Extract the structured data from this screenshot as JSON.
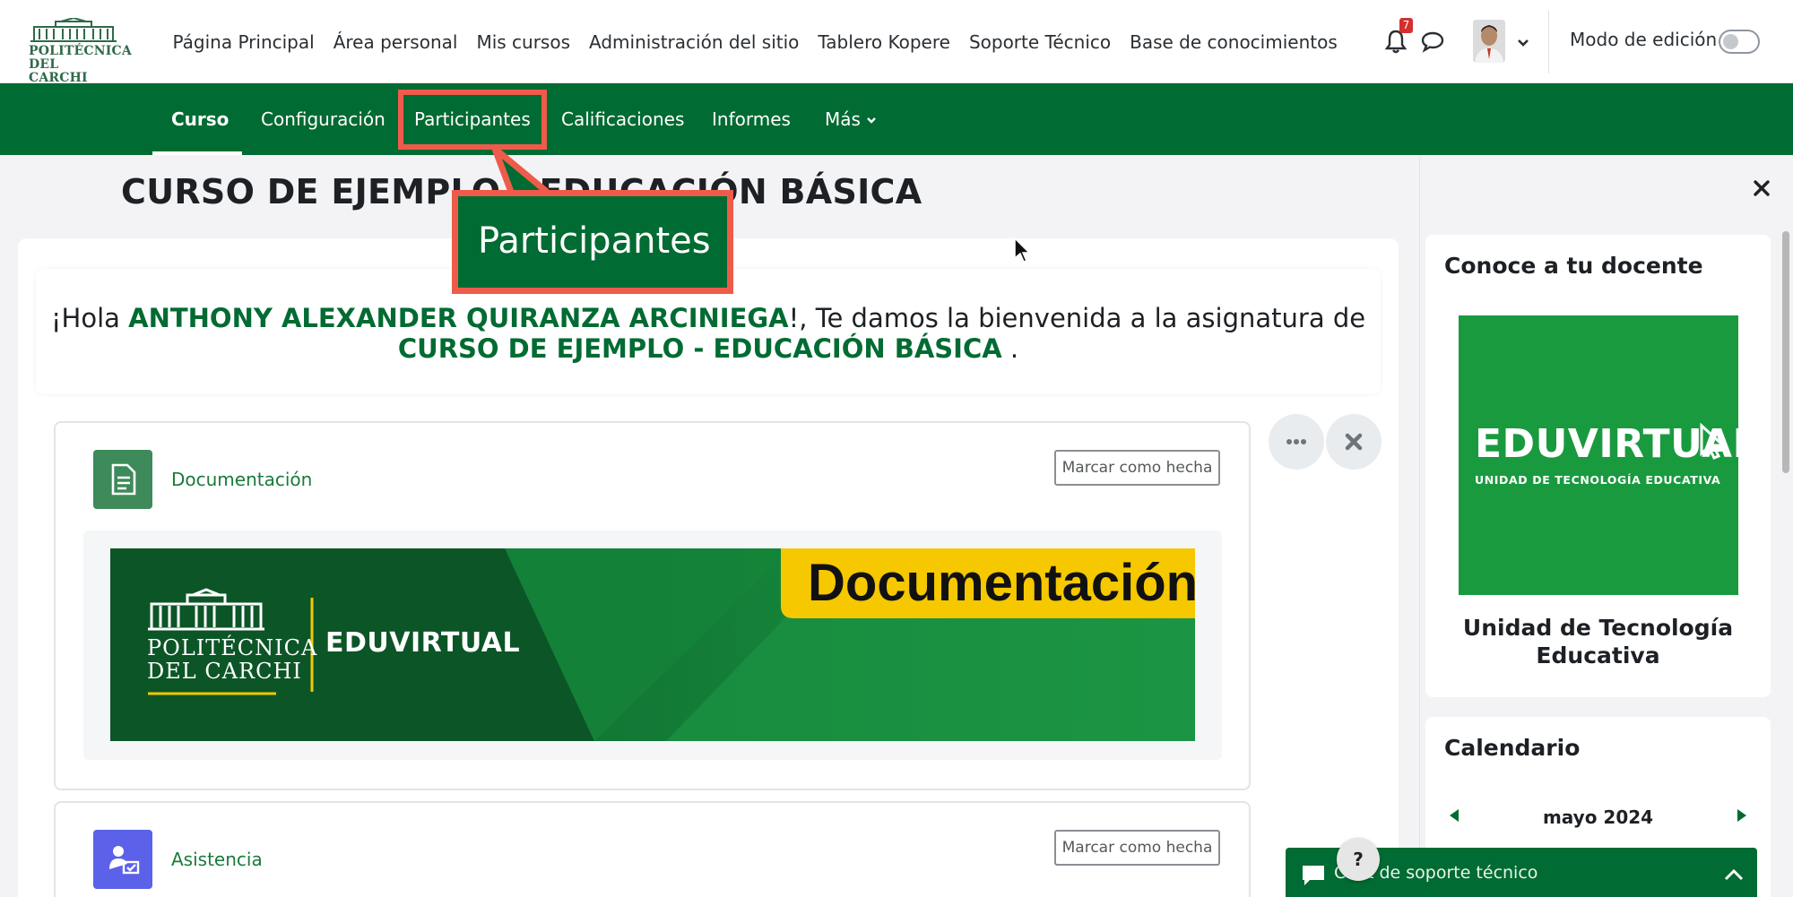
{
  "topbar": {
    "logo_text_line1": "POLITÉCNICA",
    "logo_text_line2": "DEL CARCHI",
    "nav": [
      {
        "label": "Página Principal"
      },
      {
        "label": "Área personal"
      },
      {
        "label": "Mis cursos"
      },
      {
        "label": "Administración del sitio"
      },
      {
        "label": "Tablero Kopere"
      },
      {
        "label": "Soporte Técnico"
      },
      {
        "label": "Base de conocimientos"
      }
    ],
    "notifications_count": "7",
    "edit_mode_label": "Modo de edición",
    "edit_mode_on": false
  },
  "secnav": {
    "tabs": [
      {
        "label": "Curso",
        "active": true
      },
      {
        "label": "Configuración"
      },
      {
        "label": "Participantes",
        "highlighted": true
      },
      {
        "label": "Calificaciones"
      },
      {
        "label": "Informes"
      },
      {
        "label": "Más"
      }
    ]
  },
  "callout": {
    "label": "Participantes",
    "color": "#ef5b4a"
  },
  "page": {
    "title": "CURSO DE EJEMPLO - EDUCACIÓN BÁSICA"
  },
  "welcome": {
    "prefix": "¡Hola ",
    "user_name": "ANTHONY ALEXANDER QUIRANZA ARCINIEGA",
    "middle": "!, Te damos la bienvenida a la asignatura de",
    "course_name": "CURSO DE EJEMPLO - EDUCACIÓN BÁSICA",
    "suffix": " ."
  },
  "activities": [
    {
      "name": "Documentación",
      "icon": "file-icon",
      "icon_color": "#3f8a5a",
      "mark_label": "Marcar como hecha",
      "banner": {
        "logo_line1": "POLITÉCNICA",
        "logo_line2": "DEL CARCHI",
        "brand": "EDUVIRTUAL",
        "title": "Documentación"
      }
    },
    {
      "name": "Asistencia",
      "icon": "attendance-icon",
      "icon_color": "#5b61e8",
      "mark_label": "Marcar como hecha"
    }
  ],
  "drawer": {
    "teacher_block_title": "Conoce a tu docente",
    "teacher_brand": "EDUVIRTUAL",
    "teacher_brand_sub": "UNIDAD DE TECNOLOGÍA EDUCATIVA",
    "teacher_name": "Unidad de Tecnología Educativa",
    "calendar_title": "Calendario",
    "calendar_month": "mayo 2024"
  },
  "chat": {
    "label": "Chat de soporte técnico",
    "help_label": "?"
  },
  "colors": {
    "brand_green": "#006b32",
    "link_green": "#1a7a3c",
    "banner_yellow": "#f5c800"
  }
}
